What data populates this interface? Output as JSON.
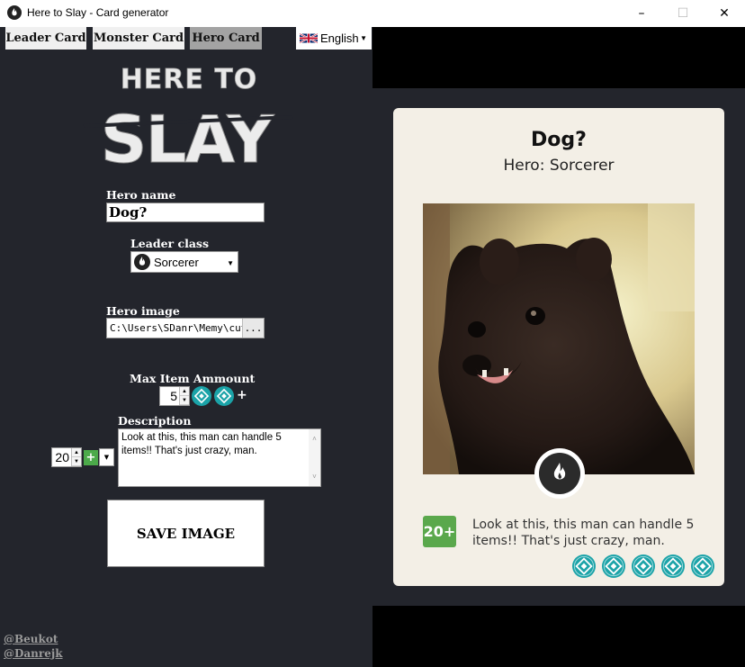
{
  "window": {
    "title": "Here to Slay - Card generator"
  },
  "tabs": [
    {
      "label": "Leader Card",
      "active": false
    },
    {
      "label": "Monster Card",
      "active": false
    },
    {
      "label": "Hero Card",
      "active": true
    }
  ],
  "language": {
    "selected": "English",
    "flag_icon": "uk-flag-icon"
  },
  "logo": {
    "line1": "HERE TO",
    "line2": "SLAY"
  },
  "form": {
    "hero_name_label": "Hero name",
    "hero_name_value": "Dog?",
    "leader_class_label": "Leader class",
    "leader_class_value": "Sorcerer",
    "hero_image_label": "Hero image",
    "hero_image_value": "C:\\Users\\SDanr\\Memy\\cute",
    "browse_label": "...",
    "max_item_label": "Max Item Ammount",
    "max_item_value": "5",
    "description_label": "Description",
    "description_value": "Look at this, this man can handle 5 items!! That's just crazy, man.",
    "roll_value": "20",
    "roll_modifier_icon": "plus-icon",
    "save_label": "SAVE IMAGE"
  },
  "credits": [
    "@Beukot",
    "@Danrejk"
  ],
  "card": {
    "name": "Dog?",
    "subtitle": "Hero: Sorcerer",
    "roll": "20+",
    "description": "Look at this, this man can handle 5 items!! That's just crazy, man.",
    "item_slots": 5,
    "class_icon": "fire-icon"
  },
  "colors": {
    "panel": "#23252c",
    "card_bg": "#f3efe6",
    "item_teal": "#1ba3a8",
    "roll_green": "#5aa84c"
  }
}
